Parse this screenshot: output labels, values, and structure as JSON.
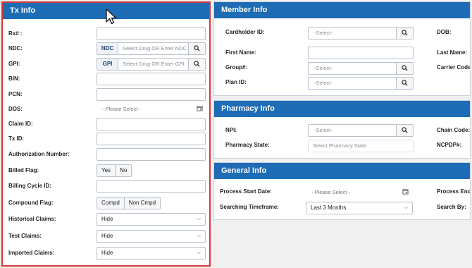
{
  "tx_info": {
    "title": "Tx Info",
    "rx_label": "Rx# :",
    "ndc_label": "NDC:",
    "ndc_tag": "NDC",
    "ndc_placeholder": "Select Drug OR Enter NDC",
    "gpi_label": "GPI:",
    "gpi_tag": "GPI",
    "gpi_placeholder": "Select Drug OR Enter GPI",
    "bin_label": "BIN:",
    "pcn_label": "PCN:",
    "dos_label": "DOS:",
    "dos_placeholder": "- Please Select -",
    "claim_id_label": "Claim ID:",
    "tx_id_label": "Tx ID:",
    "auth_label": "Authorization Number:",
    "billed_flag_label": "Billed Flag:",
    "billed_yes": "Yes",
    "billed_no": "No",
    "billing_cycle_label": "Billing Cycle ID:",
    "compound_flag_label": "Compound Flag:",
    "compound_yes": "Compd",
    "compound_no": "Non Cmpd",
    "historical_label": "Historical Claims:",
    "historical_value": "Hide",
    "test_label": "Test Claims:",
    "test_value": "Hide",
    "imported_label": "Imported Claims:",
    "imported_value": "Hide"
  },
  "member_info": {
    "title": "Member Info",
    "cardholder_label": "Cardholder ID:",
    "cardholder_placeholder": "-Select-",
    "dob_label": "DOB:",
    "first_name_label": "First Name:",
    "last_name_label": "Last Name:",
    "group_label": "Group#:",
    "group_placeholder": "-Select-",
    "carrier_label": "Carrier Code",
    "plan_label": "Plan ID:",
    "plan_placeholder": "-Select-"
  },
  "pharmacy_info": {
    "title": "Pharmacy Info",
    "npi_label": "NPI:",
    "npi_placeholder": "-Select-",
    "chain_label": "Chain Code:",
    "state_label": "Pharmacy State:",
    "state_placeholder": "Select Pharmacy State",
    "ncpdp_label": "NCPDP#:"
  },
  "general_info": {
    "title": "General Info",
    "start_label": "Process Start Date:",
    "start_placeholder": "- Please Select -",
    "end_label": "Process End",
    "timeframe_label": "Searching Timeframe:",
    "timeframe_value": "Last 3 Months",
    "search_by_label": "Search By:"
  },
  "icons": {
    "search": "magnifier-icon",
    "calendar": "calendar-icon",
    "chevron": "chevron-down-icon",
    "cursor": "mouse-cursor-icon"
  },
  "colors": {
    "header_blue": "#1e6cb5",
    "focus_red": "#d9383a"
  }
}
